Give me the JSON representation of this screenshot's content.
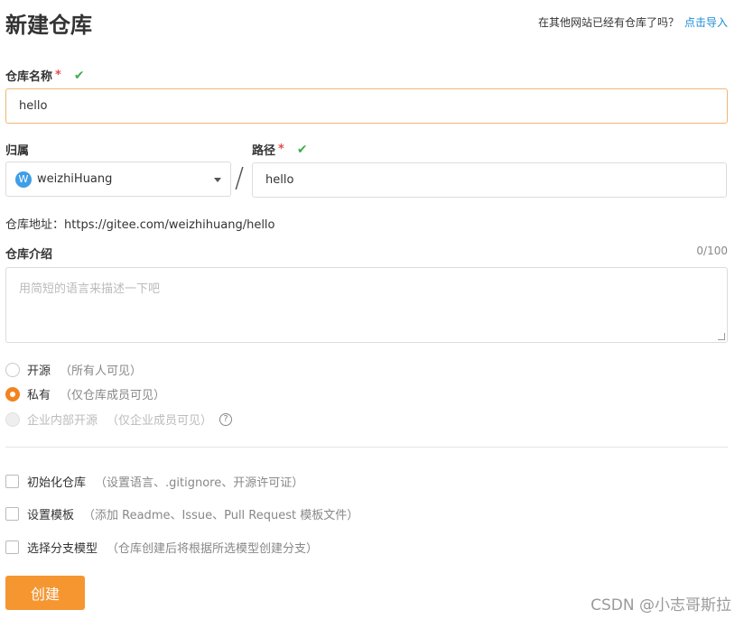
{
  "page": {
    "title": "新建仓库",
    "import_prompt": "在其他网站已经有仓库了吗？",
    "import_link": "点击导入"
  },
  "repo_name": {
    "label": "仓库名称",
    "required_mark": "*",
    "check_icon": "✔",
    "value": "hello"
  },
  "owner": {
    "label": "归属",
    "avatar_letter": "W",
    "value": "weizhiHuang"
  },
  "separator": "/",
  "path": {
    "label": "路径",
    "required_mark": "*",
    "check_icon": "✔",
    "value": "hello"
  },
  "repo_address": {
    "label": "仓库地址：",
    "value": "https://gitee.com/weizhihuang/hello"
  },
  "description": {
    "label": "仓库介绍",
    "counter": "0/100",
    "placeholder": "用简短的语言来描述一下吧"
  },
  "visibility": {
    "options": [
      {
        "label": "开源",
        "hint": "（所有人可见）",
        "checked": false,
        "disabled": false
      },
      {
        "label": "私有",
        "hint": "（仅仓库成员可见）",
        "checked": true,
        "disabled": false
      },
      {
        "label": "企业内部开源",
        "hint": "（仅企业成员可见）",
        "checked": false,
        "disabled": true
      }
    ],
    "help_icon": "?"
  },
  "options": [
    {
      "label": "初始化仓库",
      "hint": "（设置语言、.gitignore、开源许可证）"
    },
    {
      "label": "设置模板",
      "hint": "（添加 Readme、Issue、Pull Request 模板文件）"
    },
    {
      "label": "选择分支模型",
      "hint": "（仓库创建后将根据所选模型创建分支）"
    }
  ],
  "actions": {
    "create": "创建"
  },
  "watermark": "CSDN @小志哥斯拉",
  "colors": {
    "accent": "#f59631",
    "radio_checked": "#f2831f",
    "link": "#1a8bd6",
    "valid": "#3eaf4f",
    "required": "#e84a4a"
  }
}
